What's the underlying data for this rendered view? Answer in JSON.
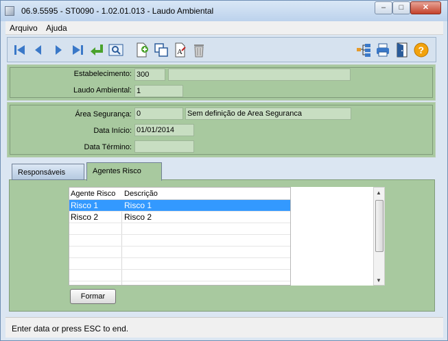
{
  "window": {
    "title": "06.9.5595 - ST0090 - 1.02.01.013 - Laudo Ambiental",
    "min_label": "–",
    "max_label": "□",
    "close_label": "✕"
  },
  "menu": {
    "items": [
      "Arquivo",
      "Ajuda"
    ]
  },
  "toolbar": {
    "icons": [
      "first-record-icon",
      "previous-record-icon",
      "next-record-icon",
      "last-record-icon",
      "go-to-icon",
      "search-zoom-icon",
      "new-record-icon",
      "copy-record-icon",
      "edit-record-icon",
      "delete-trash-icon",
      "tree-structure-icon",
      "print-icon",
      "exit-door-icon",
      "help-icon"
    ]
  },
  "header": {
    "estabelecimento_label": "Estabelecimento:",
    "estabelecimento_value": "300",
    "estabelecimento_desc": "",
    "laudo_label": "Laudo Ambiental:",
    "laudo_value": "1"
  },
  "details": {
    "area_label": "Área Segurança:",
    "area_value": "0",
    "area_desc": "Sem definição de Area Seguranca",
    "inicio_label": "Data Início:",
    "inicio_value": "01/01/2014",
    "termino_label": "Data Término:",
    "termino_value": ""
  },
  "tabs": [
    {
      "label": "Responsáveis"
    },
    {
      "label": "Agentes Risco",
      "active": true
    }
  ],
  "grid": {
    "columns": [
      "Agente Risco",
      "Descrição"
    ],
    "rows": [
      [
        "Risco 1",
        "Risco 1"
      ],
      [
        "Risco 2",
        "Risco 2"
      ]
    ]
  },
  "formar_label": "Formar",
  "status": "Enter data or press ESC to end.",
  "colors": {
    "panel": "#a8c99f",
    "selection": "#3399ff",
    "toolbar": "#d6e2ef"
  }
}
